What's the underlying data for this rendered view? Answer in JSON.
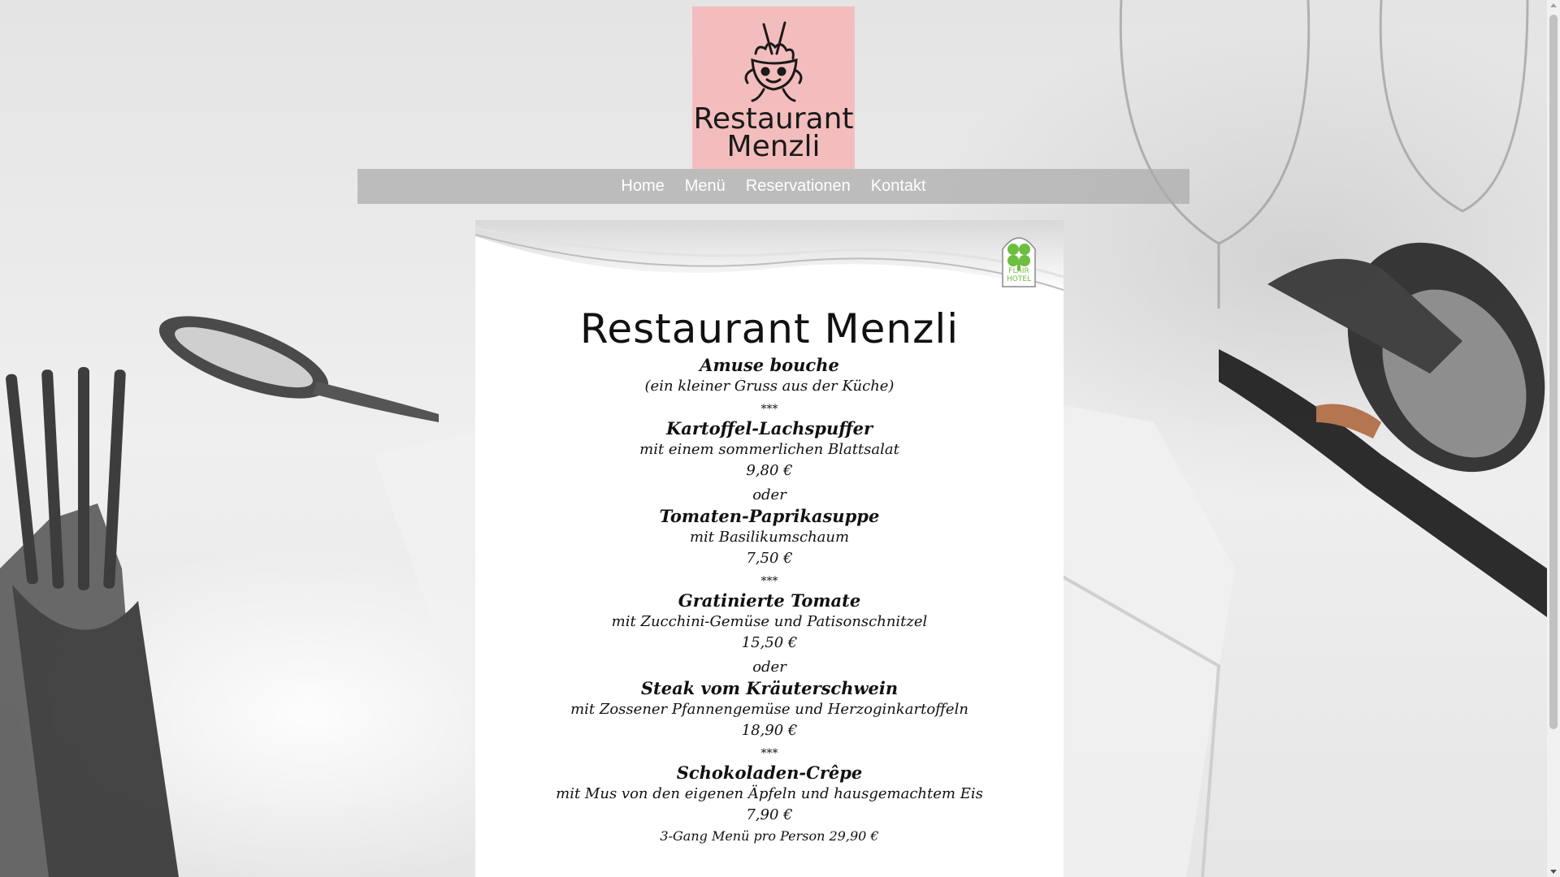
{
  "logo": {
    "line1": "Restaurant",
    "line2": "Menzli",
    "background_color": "#f4bdbd",
    "mascot_icon": "bowl-mascot-icon"
  },
  "nav": {
    "items": [
      {
        "label": "Home"
      },
      {
        "label": "Menü"
      },
      {
        "label": "Reservationen"
      },
      {
        "label": "Kontakt"
      }
    ]
  },
  "menu": {
    "badge": {
      "line1": "FLAIR",
      "line2": "HOTEL",
      "icon": "clover-icon",
      "color": "#6cbf3f"
    },
    "title": "Restaurant Menzli",
    "amuse": {
      "name": "Amuse bouche",
      "desc": "(ein kleiner Gruss aus der Küche)"
    },
    "separator": "***",
    "or": "oder",
    "starter_1": {
      "name": "Kartoffel-Lachspuffer",
      "desc": "mit einem sommerlichen Blattsalat",
      "price": "9,80 €"
    },
    "starter_2": {
      "name": "Tomaten-Paprikasuppe",
      "desc": "mit Basilikumschaum",
      "price": "7,50 €"
    },
    "main_1": {
      "name": "Gratinierte Tomate",
      "desc": "mit Zucchini-Gemüse und Patisonschnitzel",
      "price": "15,50 €"
    },
    "main_2": {
      "name": "Steak vom Kräuterschwein",
      "desc": "mit Zossener Pfannengemüse und Herzoginkartoffeln",
      "price": "18,90 €"
    },
    "dessert": {
      "name": "Schokoladen-Crêpe",
      "desc": "mit Mus von den eigenen Äpfeln und hausgemachtem Eis",
      "price": "7,90 €"
    },
    "menu_price": "3-Gang Menü pro Person 29,90 €"
  }
}
